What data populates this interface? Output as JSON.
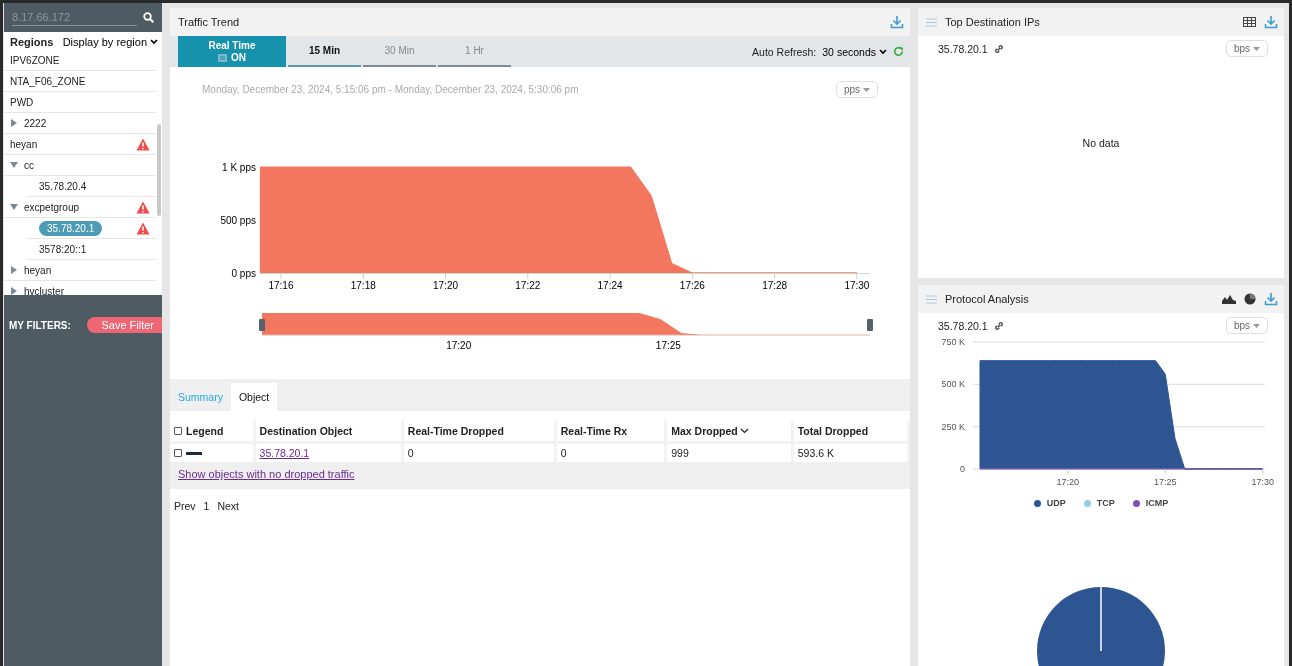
{
  "sidebar": {
    "search": {
      "placeholder": "8.17.66.172"
    },
    "regions_label": "Regions",
    "display_select": "Display by region",
    "tree": [
      {
        "label": "IPV6ZONE",
        "kind": "region",
        "alert": false,
        "selected": false
      },
      {
        "label": "NTA_F06_ZONE",
        "kind": "region",
        "alert": false,
        "selected": false
      },
      {
        "label": "PWD",
        "kind": "region",
        "alert": false,
        "selected": false
      },
      {
        "label": "2222",
        "kind": "group",
        "expanded": false,
        "alert": false,
        "selected": false
      },
      {
        "label": "heyan",
        "kind": "region",
        "alert": true,
        "selected": false
      },
      {
        "label": "cc",
        "kind": "group",
        "expanded": true,
        "alert": false,
        "selected": false,
        "children": [
          {
            "label": "35.78.20.4",
            "kind": "region",
            "alert": false,
            "selected": false
          }
        ]
      },
      {
        "label": "excpetgroup",
        "kind": "group",
        "expanded": true,
        "alert": true,
        "selected": false,
        "children": [
          {
            "label": "35.78.20.1",
            "kind": "region",
            "alert": true,
            "selected": true
          },
          {
            "label": "3578:20::1",
            "kind": "region",
            "alert": false,
            "selected": false
          }
        ]
      },
      {
        "label": "heyan",
        "kind": "group",
        "expanded": false,
        "alert": false,
        "selected": false
      },
      {
        "label": "hvcluster",
        "kind": "group",
        "expanded": false,
        "alert": false,
        "selected": false
      }
    ],
    "filters_label": "MY FILTERS:",
    "save_filter": "Save Filter"
  },
  "traffic_trend": {
    "title": "Traffic Trend",
    "realtime": {
      "label": "Real Time",
      "state": "ON",
      "on": true
    },
    "ranges": [
      {
        "label": "15 Min",
        "selected": true
      },
      {
        "label": "30 Min",
        "selected": false
      },
      {
        "label": "1 Hr",
        "selected": false
      }
    ],
    "auto_refresh_label": "Auto Refresh:",
    "auto_refresh_value": "30 seconds",
    "date_range": "Monday, December 23, 2024, 5:15:06 pm - Monday, December 23, 2024, 5:30:06 pm",
    "unit": "pps",
    "chart_data": {
      "type": "area",
      "categories": [
        null,
        "17:16",
        null,
        null,
        null,
        "17:18",
        null,
        null,
        null,
        "17:20",
        null,
        null,
        null,
        "17:22",
        null,
        null,
        null,
        "17:24",
        null,
        null,
        null,
        "17:26",
        null,
        null,
        null,
        "17:28",
        null,
        null,
        null,
        "17:30"
      ],
      "values": [
        1000,
        1000,
        1000,
        1000,
        1000,
        1000,
        1000,
        1000,
        1000,
        1000,
        1000,
        1000,
        1000,
        1000,
        1000,
        1000,
        1000,
        1000,
        1000,
        730,
        90,
        0,
        0,
        0,
        0,
        0,
        0,
        0,
        0,
        0
      ],
      "ylim": [
        0,
        1000
      ],
      "yticks": [
        {
          "value": 0,
          "label": "0 pps"
        },
        {
          "value": 500,
          "label": "500 pps"
        },
        {
          "value": 1000,
          "label": "1 K pps"
        }
      ]
    },
    "navigator": {
      "labels": [
        "17:20",
        "17:25"
      ]
    }
  },
  "detail_tabs": [
    {
      "label": "Summary",
      "selected": false
    },
    {
      "label": "Object",
      "selected": true
    }
  ],
  "table": {
    "header_checked": false,
    "columns": [
      {
        "label": "Legend",
        "sorted": false
      },
      {
        "label": "Destination Object",
        "sorted": false
      },
      {
        "label": "Real-Time Dropped",
        "sorted": false
      },
      {
        "label": "Real-Time Rx",
        "sorted": false
      },
      {
        "label": "Max Dropped",
        "sorted": true
      },
      {
        "label": "Total Dropped",
        "sorted": false
      }
    ],
    "rows": [
      {
        "checked": false,
        "cells": [
          "",
          "35.78.20.1",
          "0",
          "0",
          "999",
          "593.6 K"
        ]
      }
    ]
  },
  "show_link": "Show objects with no dropped traffic",
  "pagination": {
    "prev": "Prev",
    "page": "1",
    "next": "Next"
  },
  "top_destination": {
    "title": "Top Destination IPs",
    "target": "35.78.20.1",
    "unit": "bps",
    "empty": "No data"
  },
  "protocol": {
    "title": "Protocol Analysis",
    "target": "35.78.20.1",
    "unit": "bps",
    "chart_data": {
      "type": "area",
      "categories": [
        null,
        null,
        null,
        null,
        null,
        null,
        null,
        null,
        null,
        "17:20",
        null,
        null,
        null,
        null,
        null,
        null,
        null,
        null,
        null,
        "17:25",
        null,
        null,
        null,
        null,
        null,
        null,
        null,
        null,
        null,
        "17:30"
      ],
      "values": [
        640000,
        640000,
        640000,
        640000,
        640000,
        640000,
        640000,
        640000,
        640000,
        640000,
        640000,
        640000,
        640000,
        640000,
        640000,
        640000,
        640000,
        640000,
        640000,
        560000,
        180000,
        0,
        0,
        0,
        0,
        0,
        0,
        0,
        0,
        0
      ],
      "ylim": [
        0,
        750000
      ],
      "yticks": [
        {
          "value": 0,
          "label": "0"
        },
        {
          "value": 250000,
          "label": "250 K"
        },
        {
          "value": 500000,
          "label": "500 K"
        },
        {
          "value": 750000,
          "label": "750 K"
        }
      ]
    },
    "legend": [
      {
        "name": "UDP",
        "color": "#2d5592"
      },
      {
        "name": "TCP",
        "color": "#8fd0e8"
      },
      {
        "name": "ICMP",
        "color": "#7f4fb5"
      }
    ]
  }
}
